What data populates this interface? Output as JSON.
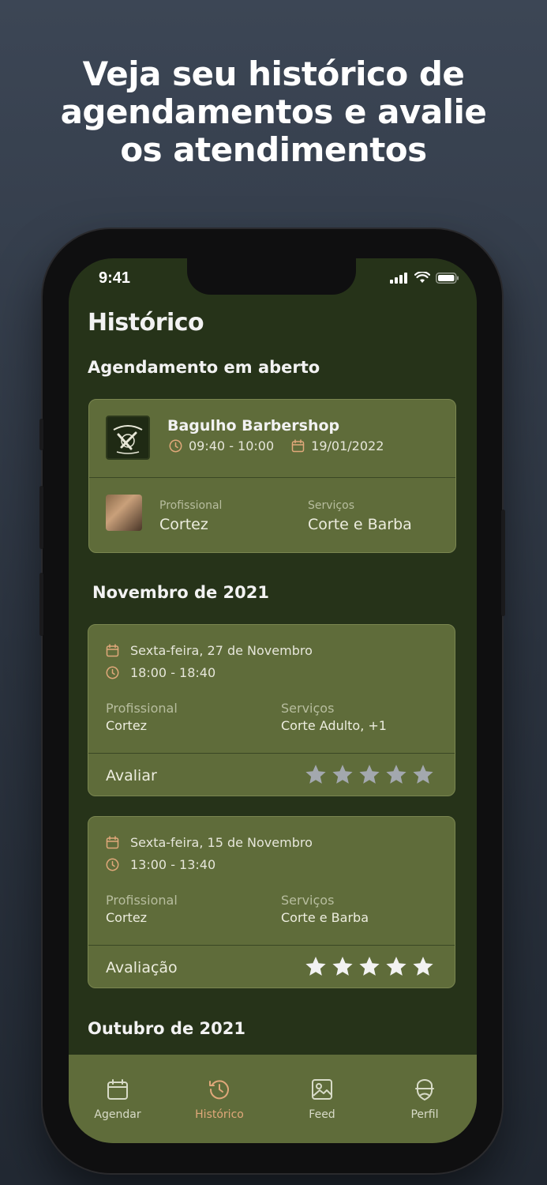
{
  "headline": {
    "line1": "Veja seu histórico de",
    "line2": "agendamentos e avalie",
    "line3": "os atendimentos"
  },
  "status_bar": {
    "time": "9:41"
  },
  "page": {
    "title": "Histórico"
  },
  "open_appointment": {
    "section_title": "Agendamento em aberto",
    "shop_name": "Bagulho Barbershop",
    "time_range": "09:40 - 10:00",
    "date": "19/01/2022",
    "professional_label": "Profissional",
    "professional": "Cortez",
    "services_label": "Serviços",
    "services": "Corte e Barba"
  },
  "months": [
    {
      "title": "Novembro de 2021",
      "appointments": [
        {
          "date": "Sexta-feira, 27 de Novembro",
          "time_range": "18:00 - 18:40",
          "professional_label": "Profissional",
          "professional": "Cortez",
          "services_label": "Serviços",
          "services": "Corte Adulto, +1",
          "rating_label": "Avaliar",
          "rating": 0
        },
        {
          "date": "Sexta-feira, 15 de Novembro",
          "time_range": "13:00 - 13:40",
          "professional_label": "Profissional",
          "professional": "Cortez",
          "services_label": "Serviços",
          "services": "Corte e Barba",
          "rating_label": "Avaliação",
          "rating": 5
        }
      ]
    },
    {
      "title": "Outubro de 2021"
    }
  ],
  "tabbar": {
    "items": [
      {
        "label": "Agendar",
        "icon": "calendar-icon"
      },
      {
        "label": "Histórico",
        "icon": "history-icon",
        "active": true
      },
      {
        "label": "Feed",
        "icon": "image-icon"
      },
      {
        "label": "Perfil",
        "icon": "profile-icon"
      }
    ]
  },
  "colors": {
    "screen_bg": "#263319",
    "card_bg": "#5f6c3a",
    "accent": "#e0a87a",
    "star_empty": "#a3a8ae",
    "star_filled": "#f2f2f2"
  }
}
